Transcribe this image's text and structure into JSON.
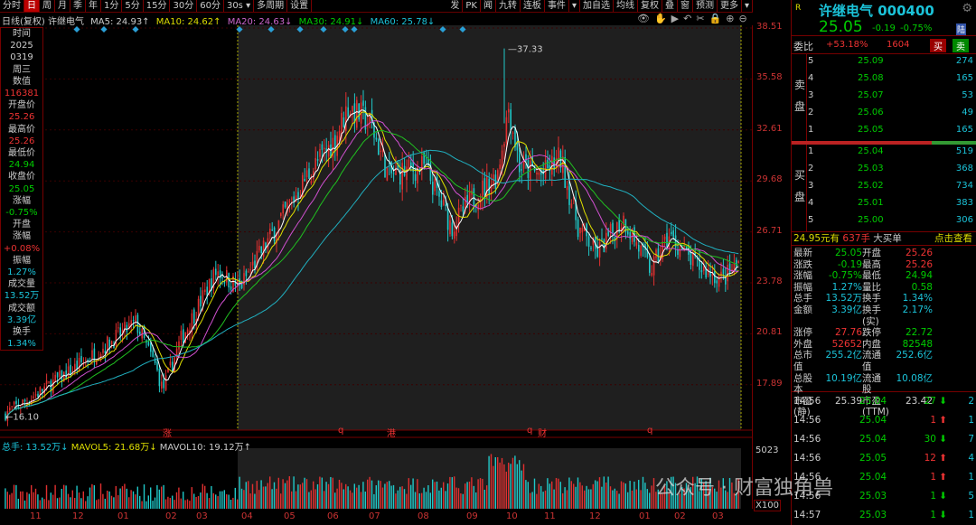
{
  "toolbar": {
    "items": [
      "分时",
      "日",
      "周",
      "月",
      "季",
      "年",
      "1分",
      "5分",
      "15分",
      "30分",
      "60分",
      "30s ▾",
      "多周期",
      "设置",
      "发",
      "PK",
      "闻",
      "九转",
      "连板",
      "事件",
      "▾",
      "加自选",
      "均线",
      "复权",
      "叠",
      "窗",
      "预测",
      "更多",
      "▾"
    ],
    "active": "日"
  },
  "ma": {
    "title": "日线(复权)  许继电气",
    "ma5": "MA5: 24.93↑",
    "ma10": "MA10: 24.62↑",
    "ma20": "MA20: 24.63↓",
    "ma30": "MA30: 24.91↓",
    "ma60": "MA60: 25.78↓"
  },
  "tools": "👁✋▶↶✂🔒⊕⊖",
  "info": [
    [
      "时间",
      "w"
    ],
    [
      "2025",
      "w"
    ],
    [
      "0319",
      "w"
    ],
    [
      "周三",
      "w"
    ],
    [
      "数值",
      "w"
    ],
    [
      "116381",
      "r"
    ],
    [
      "开盘价",
      "w"
    ],
    [
      "25.26",
      "r"
    ],
    [
      "最高价",
      "w"
    ],
    [
      "25.26",
      "r"
    ],
    [
      "最低价",
      "w"
    ],
    [
      "24.94",
      "g"
    ],
    [
      "收盘价",
      "w"
    ],
    [
      "25.05",
      "g"
    ],
    [
      "涨幅",
      "w"
    ],
    [
      "-0.75%",
      "g"
    ],
    [
      "开盘",
      "w"
    ],
    [
      "涨幅",
      "w"
    ],
    [
      "+0.08%",
      "r"
    ],
    [
      "振幅",
      "w"
    ],
    [
      "1.27%",
      "c"
    ],
    [
      "成交量",
      "w"
    ],
    [
      "13.52万",
      "c"
    ],
    [
      "成交额",
      "w"
    ],
    [
      "3.39亿",
      "c"
    ],
    [
      "换手",
      "w"
    ],
    [
      "1.34%",
      "c"
    ]
  ],
  "axis_ticks": [
    "38.51",
    "35.58",
    "32.61",
    "29.68",
    "26.71",
    "23.78",
    "20.81",
    "17.89"
  ],
  "vol_axis": {
    "top": "5023",
    "unit": "X100"
  },
  "markers": {
    "zhang": "涨",
    "q1": "q",
    "gang": "港",
    "q2": "q",
    "cai": "财",
    "q3": "q"
  },
  "vol_line": {
    "total": "总手: 13.52万↓",
    "mavol5": "MAVOL5: 21.68万↓",
    "mavol10": "MAVOL10: 19.12万↑"
  },
  "months": [
    "11",
    "12",
    "01",
    "02",
    "03",
    "04",
    "05",
    "06",
    "07",
    "08",
    "09",
    "10",
    "11",
    "12",
    "01",
    "02",
    "03"
  ],
  "chart_data": {
    "type": "candlestick",
    "high_label": "37.33",
    "low_label": "16.10",
    "price_path": [
      [
        0,
        16.1
      ],
      [
        30,
        17
      ],
      [
        100,
        19.5
      ],
      [
        150,
        21.5
      ],
      [
        172,
        19
      ],
      [
        180,
        17.6
      ],
      [
        200,
        20.5
      ],
      [
        240,
        24.5
      ],
      [
        265,
        23.5
      ],
      [
        300,
        26.5
      ],
      [
        340,
        30
      ],
      [
        370,
        32
      ],
      [
        385,
        34
      ],
      [
        410,
        33
      ],
      [
        430,
        30
      ],
      [
        470,
        30.5
      ],
      [
        500,
        27
      ],
      [
        520,
        28.5
      ],
      [
        550,
        30
      ],
      [
        563,
        34
      ],
      [
        575,
        30.5
      ],
      [
        600,
        30
      ],
      [
        620,
        31
      ],
      [
        640,
        27
      ],
      [
        660,
        25.5
      ],
      [
        690,
        27.5
      ],
      [
        720,
        24.5
      ],
      [
        740,
        26.5
      ],
      [
        770,
        24.8
      ],
      [
        800,
        24
      ],
      [
        820,
        25.05
      ]
    ],
    "ylim": [
      17.89,
      38.51
    ],
    "colors": {
      "up": "#e03030",
      "down": "#20c8c8",
      "ma5": "#ffffff",
      "ma10": "#e0e000",
      "ma20": "#d050d0",
      "ma30": "#20c020",
      "ma60": "#20b0c0"
    }
  },
  "quote": {
    "badge": "R",
    "name": "许继电气 000400",
    "price": "25.05",
    "chg": "-0.19",
    "pct": "-0.75%",
    "lu": "陆",
    "wb_label": "委比",
    "wb": "+53.18%",
    "wc": "1604",
    "buy": "买",
    "sell": "卖",
    "sell_label": "卖盘",
    "buy_label": "买盘",
    "asks": [
      [
        "5",
        "25.09",
        "274"
      ],
      [
        "4",
        "25.08",
        "165"
      ],
      [
        "3",
        "25.07",
        "53"
      ],
      [
        "2",
        "25.06",
        "49"
      ],
      [
        "1",
        "25.05",
        "165"
      ]
    ],
    "bids": [
      [
        "1",
        "25.04",
        "519"
      ],
      [
        "2",
        "25.03",
        "368"
      ],
      [
        "3",
        "25.02",
        "734"
      ],
      [
        "4",
        "25.01",
        "383"
      ],
      [
        "5",
        "25.00",
        "306"
      ]
    ],
    "big_price": "24.95元有",
    "big_qty": "637手",
    "big_label": "大买单",
    "big_link": "点击查看",
    "stats": [
      [
        "最新",
        "25.05",
        "g",
        "开盘",
        "25.26",
        "r"
      ],
      [
        "涨跌",
        "-0.19",
        "g",
        "最高",
        "25.26",
        "r"
      ],
      [
        "涨幅",
        "-0.75%",
        "g",
        "最低",
        "24.94",
        "g"
      ],
      [
        "振幅",
        "1.27%",
        "c",
        "量比",
        "0.58",
        "g"
      ],
      [
        "总手",
        "13.52万",
        "c",
        "换手",
        "1.34%",
        "c"
      ],
      [
        "金额",
        "3.39亿",
        "c",
        "换手(实)",
        "2.17%",
        "c"
      ],
      [
        "涨停",
        "27.76",
        "r",
        "跌停",
        "22.72",
        "g"
      ],
      [
        "外盘",
        "52652",
        "r",
        "内盘",
        "82548",
        "g"
      ],
      [
        "总市值",
        "255.2亿",
        "c",
        "流通值",
        "252.6亿",
        "c"
      ],
      [
        "总股本",
        "10.19亿",
        "c",
        "流通股",
        "10.08亿",
        "c"
      ],
      [
        "市盈(静)",
        "25.39",
        "w",
        "市盈(TTM)",
        "23.42",
        "w"
      ]
    ],
    "ticks": [
      [
        "14:56",
        "25.04",
        "27",
        "down",
        "2"
      ],
      [
        "14:56",
        "25.04",
        "1",
        "up",
        "1"
      ],
      [
        "14:56",
        "25.04",
        "30",
        "down",
        "7"
      ],
      [
        "14:56",
        "25.05",
        "12",
        "up",
        "4"
      ],
      [
        "14:56",
        "25.04",
        "1",
        "up",
        "1"
      ],
      [
        "14:56",
        "25.03",
        "1",
        "down",
        "5"
      ],
      [
        "14:57",
        "25.03",
        "1",
        "down",
        "1"
      ]
    ]
  },
  "watermark": "公众号 · 财富独角兽"
}
